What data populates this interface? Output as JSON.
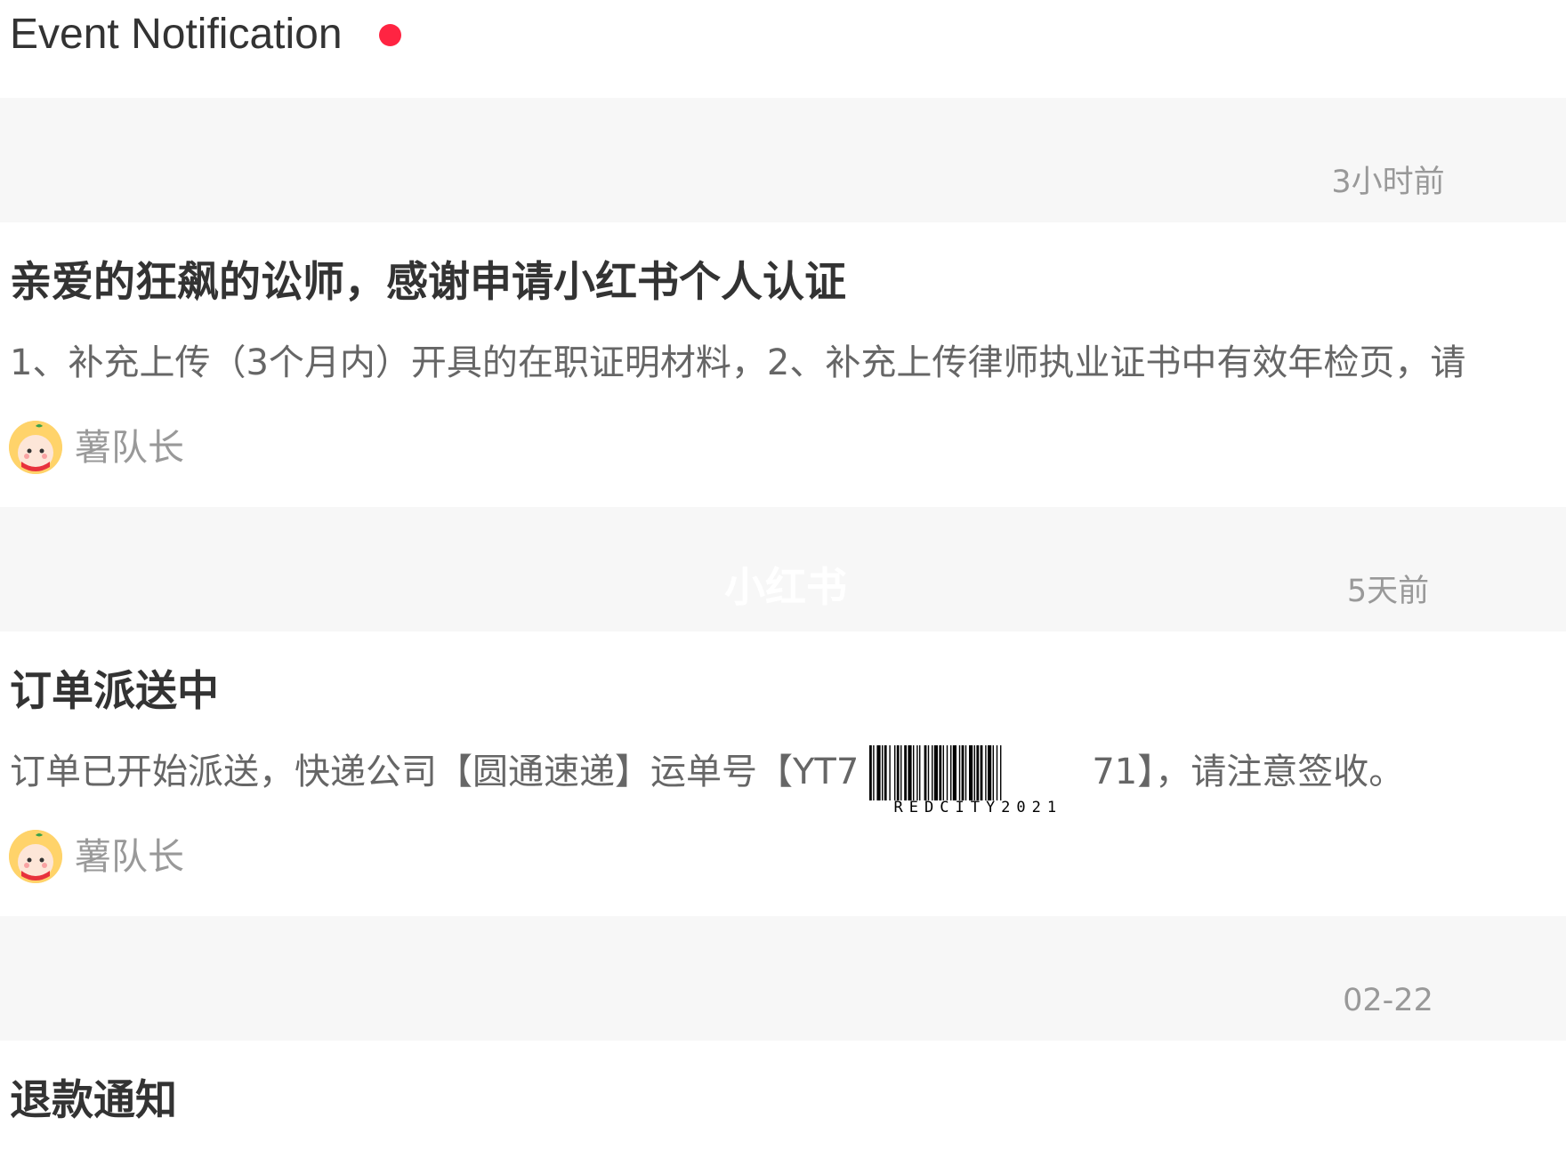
{
  "header": {
    "title": "Event Notification",
    "unread": true,
    "accent_color": "#ff2442"
  },
  "notifications": [
    {
      "time": "3小时前",
      "title": "亲爱的狂飙的讼师，感谢申请小红书个人认证",
      "body": "1、补充上传（3个月内）开具的在职证明材料，2、补充上传律师执业证书中有效年检页，请",
      "author": "薯队长",
      "avatar_icon": "mascot-avatar-icon"
    },
    {
      "time": "5天前",
      "title": "订单派送中",
      "body_prefix": "订单已开始派送，快递公司【圆通速递】运单号【YT7",
      "barcode_label": "REDCITY2021",
      "body_suffix": "71】，请注意签收。",
      "author": "薯队长",
      "avatar_icon": "mascot-avatar-icon"
    },
    {
      "time": "02-22",
      "title": "退款通知"
    }
  ],
  "watermark": "小红书"
}
